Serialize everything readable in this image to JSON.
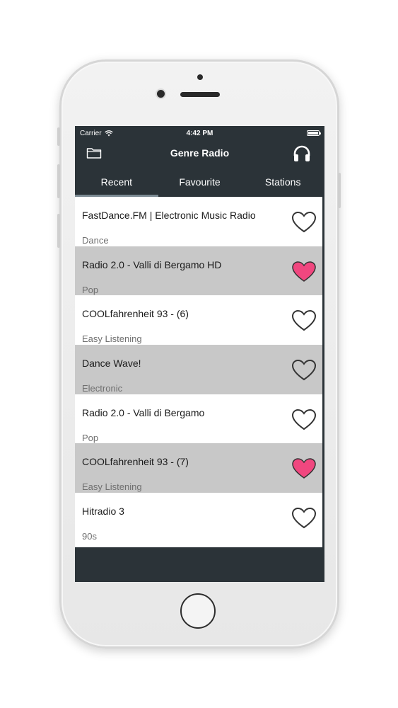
{
  "status_bar": {
    "carrier": "Carrier",
    "time": "4:42 PM",
    "wifi_icon": "wifi-icon",
    "battery_icon": "battery-icon"
  },
  "nav": {
    "title": "Genre Radio",
    "left_icon": "folder-icon",
    "right_icon": "headphones-icon"
  },
  "tabs": [
    {
      "label": "Recent",
      "active": true
    },
    {
      "label": "Favourite",
      "active": false
    },
    {
      "label": "Stations",
      "active": false
    }
  ],
  "stations": [
    {
      "title": "FastDance.FM | Electronic Music Radio",
      "genre": "Dance",
      "favourite": false
    },
    {
      "title": "Radio 2.0 - Valli di Bergamo HD",
      "genre": "Pop",
      "favourite": true
    },
    {
      "title": "COOLfahrenheit 93 - (6)",
      "genre": "Easy Listening",
      "favourite": false
    },
    {
      "title": "Dance Wave!",
      "genre": "Electronic",
      "favourite": false
    },
    {
      "title": "Radio 2.0 - Valli di Bergamo",
      "genre": "Pop",
      "favourite": false
    },
    {
      "title": "COOLfahrenheit 93 - (7)",
      "genre": "Easy Listening",
      "favourite": true
    },
    {
      "title": "Hitradio 3",
      "genre": "90s",
      "favourite": false
    }
  ],
  "colors": {
    "header_bg": "#2b3338",
    "row_shaded": "#c8c8c8",
    "heart_favourite": "#f0477f",
    "heart_outline": "#333333"
  }
}
